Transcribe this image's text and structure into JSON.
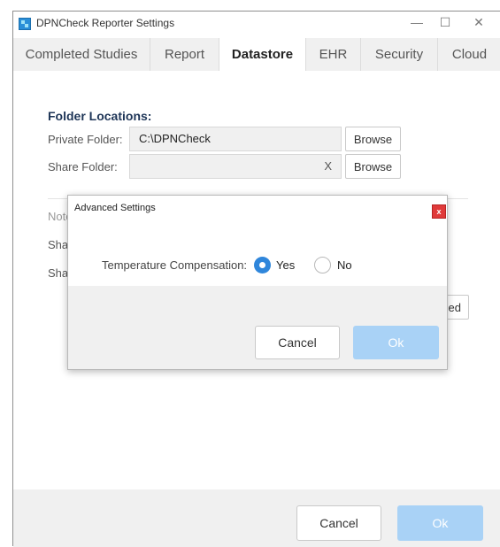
{
  "window": {
    "title": "DPNCheck Reporter Settings",
    "controls": {
      "minimize": "—",
      "maximize": "☐",
      "close": "✕"
    }
  },
  "tabs": [
    {
      "label": "Completed Studies",
      "active": false
    },
    {
      "label": "Report",
      "active": false
    },
    {
      "label": "Datastore",
      "active": true
    },
    {
      "label": "EHR",
      "active": false
    },
    {
      "label": "Security",
      "active": false
    },
    {
      "label": "Cloud",
      "active": false
    }
  ],
  "datastore": {
    "section_title": "Folder Locations:",
    "private_folder": {
      "label": "Private Folder:",
      "value": "C:\\DPNCheck",
      "button": "Browse"
    },
    "share_folder": {
      "label": "Share Folder:",
      "value": "",
      "clear": "X",
      "button": "Browse"
    },
    "note_partial": "Note",
    "share_row1_partial": "Shar",
    "share_row2_partial": "Shar",
    "advanced_button_partial": "ed"
  },
  "footer": {
    "cancel_label": "Cancel",
    "ok_label": "Ok"
  },
  "dialog": {
    "title": "Advanced Settings",
    "close_label": "x",
    "temperature_label": "Temperature Compensation:",
    "options": [
      {
        "label": "Yes",
        "selected": true
      },
      {
        "label": "No",
        "selected": false
      }
    ],
    "cancel_label": "Cancel",
    "ok_label": "Ok"
  },
  "colors": {
    "accent": "#2f86db",
    "ok_button": "#a9d2f6",
    "close_button": "#e03a3a",
    "section_title": "#1e3557",
    "panel_bg": "#f0f0f0"
  },
  "icons": {
    "app": "dpncheck-app-icon",
    "dialog_close": "close-icon"
  }
}
